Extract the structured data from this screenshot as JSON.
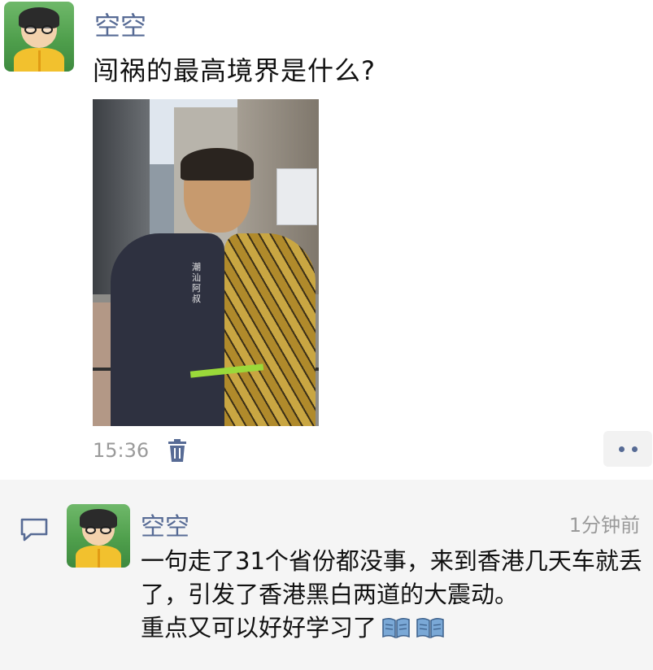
{
  "post": {
    "author": "空空",
    "text": "闯祸的最高境界是什么?",
    "time": "15:36",
    "image_alt_text": [
      "潮汕",
      "阿叔"
    ]
  },
  "comment": {
    "author": "空空",
    "time_ago": "1分钟前",
    "line1": "一句走了31个省份都没事，来到香港几天车就丢了，引发了香港黑白两道的大震动。",
    "line2": "重点又可以好好学习了"
  },
  "icons": {
    "trash": "trash-icon",
    "more": "more-dots-icon",
    "comment": "comment-icon",
    "book": "open-book-icon"
  },
  "colors": {
    "name_blue": "#576b95",
    "meta_gray": "#9a9a9a",
    "comment_bg": "#f5f5f5"
  }
}
